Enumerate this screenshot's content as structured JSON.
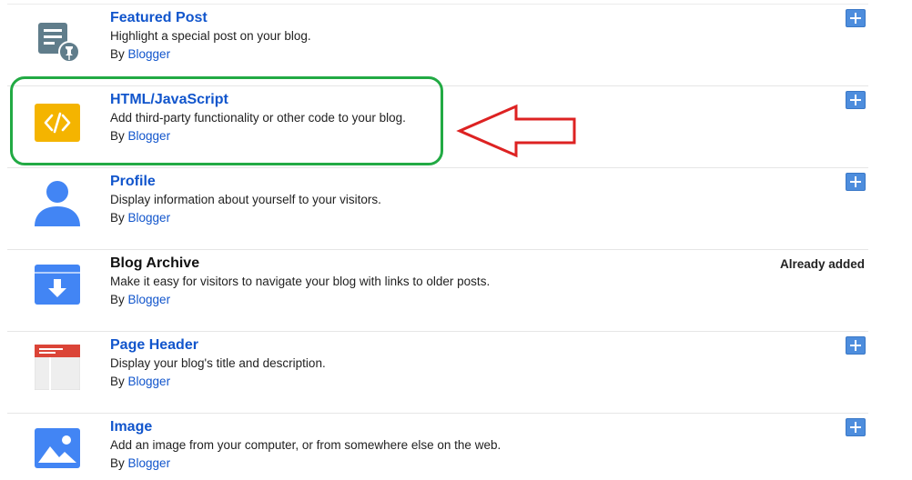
{
  "gadgets": [
    {
      "title": "Featured Post",
      "description": "Highlight a special post on your blog.",
      "by": "By",
      "author": "Blogger",
      "icon": "featured-post-icon",
      "action": "add"
    },
    {
      "title": "HTML/JavaScript",
      "description": "Add third-party functionality or other code to your blog.",
      "by": "By",
      "author": "Blogger",
      "icon": "code-icon",
      "action": "add"
    },
    {
      "title": "Profile",
      "description": "Display information about yourself to your visitors.",
      "by": "By",
      "author": "Blogger",
      "icon": "profile-icon",
      "action": "add"
    },
    {
      "title": "Blog Archive",
      "description": "Make it easy for visitors to navigate your blog with links to older posts.",
      "by": "By",
      "author": "Blogger",
      "icon": "archive-icon",
      "action": "added",
      "status": "Already added"
    },
    {
      "title": "Page Header",
      "description": "Display your blog's title and description.",
      "by": "By",
      "author": "Blogger",
      "icon": "page-header-icon",
      "action": "add"
    },
    {
      "title": "Image",
      "description": "Add an image from your computer, or from somewhere else on the web.",
      "by": "By",
      "author": "Blogger",
      "icon": "image-icon",
      "action": "add"
    }
  ],
  "colors": {
    "link": "#1155cc",
    "add_button": "#4d8ddd",
    "highlight": "#22aa44",
    "arrow": "#dd2222",
    "code_icon": "#f4b400",
    "blue_icon": "#4285f4",
    "header_icon": "#db4437"
  }
}
